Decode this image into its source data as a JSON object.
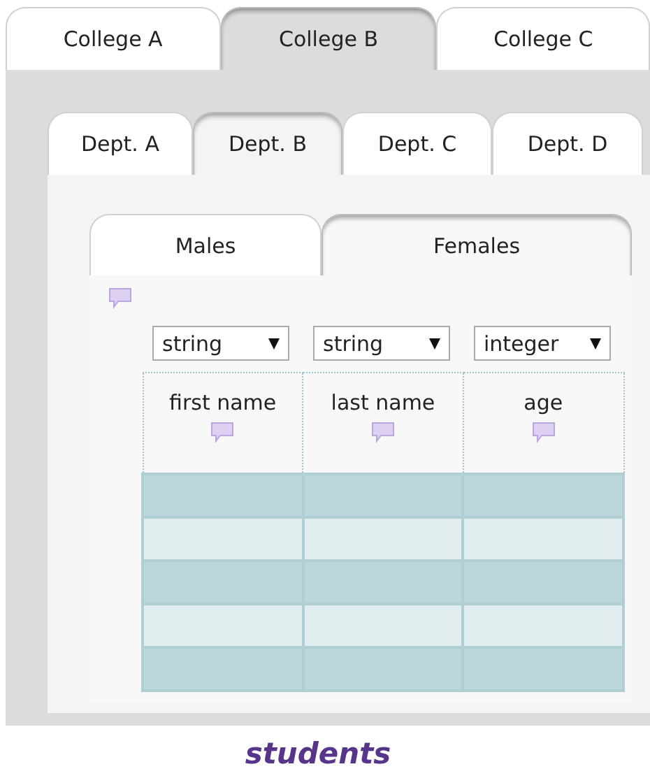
{
  "colleges": [
    {
      "label": "College A",
      "selected": false
    },
    {
      "label": "College B",
      "selected": true
    },
    {
      "label": "College C",
      "selected": false
    }
  ],
  "departments": [
    {
      "label": "Dept. A",
      "selected": false
    },
    {
      "label": "Dept. B",
      "selected": true
    },
    {
      "label": "Dept. C",
      "selected": false
    },
    {
      "label": "Dept. D",
      "selected": false
    }
  ],
  "groups": [
    {
      "label": "Males",
      "selected": false
    },
    {
      "label": "Females",
      "selected": true
    }
  ],
  "table": {
    "columns": [
      {
        "type": "string",
        "heading": "first name"
      },
      {
        "type": "string",
        "heading": "last name"
      },
      {
        "type": "integer",
        "heading": "age"
      }
    ],
    "rows": [
      {
        "alternate": false
      },
      {
        "alternate": true
      },
      {
        "alternate": false
      },
      {
        "alternate": true
      },
      {
        "alternate": false
      }
    ]
  },
  "caption": "students"
}
